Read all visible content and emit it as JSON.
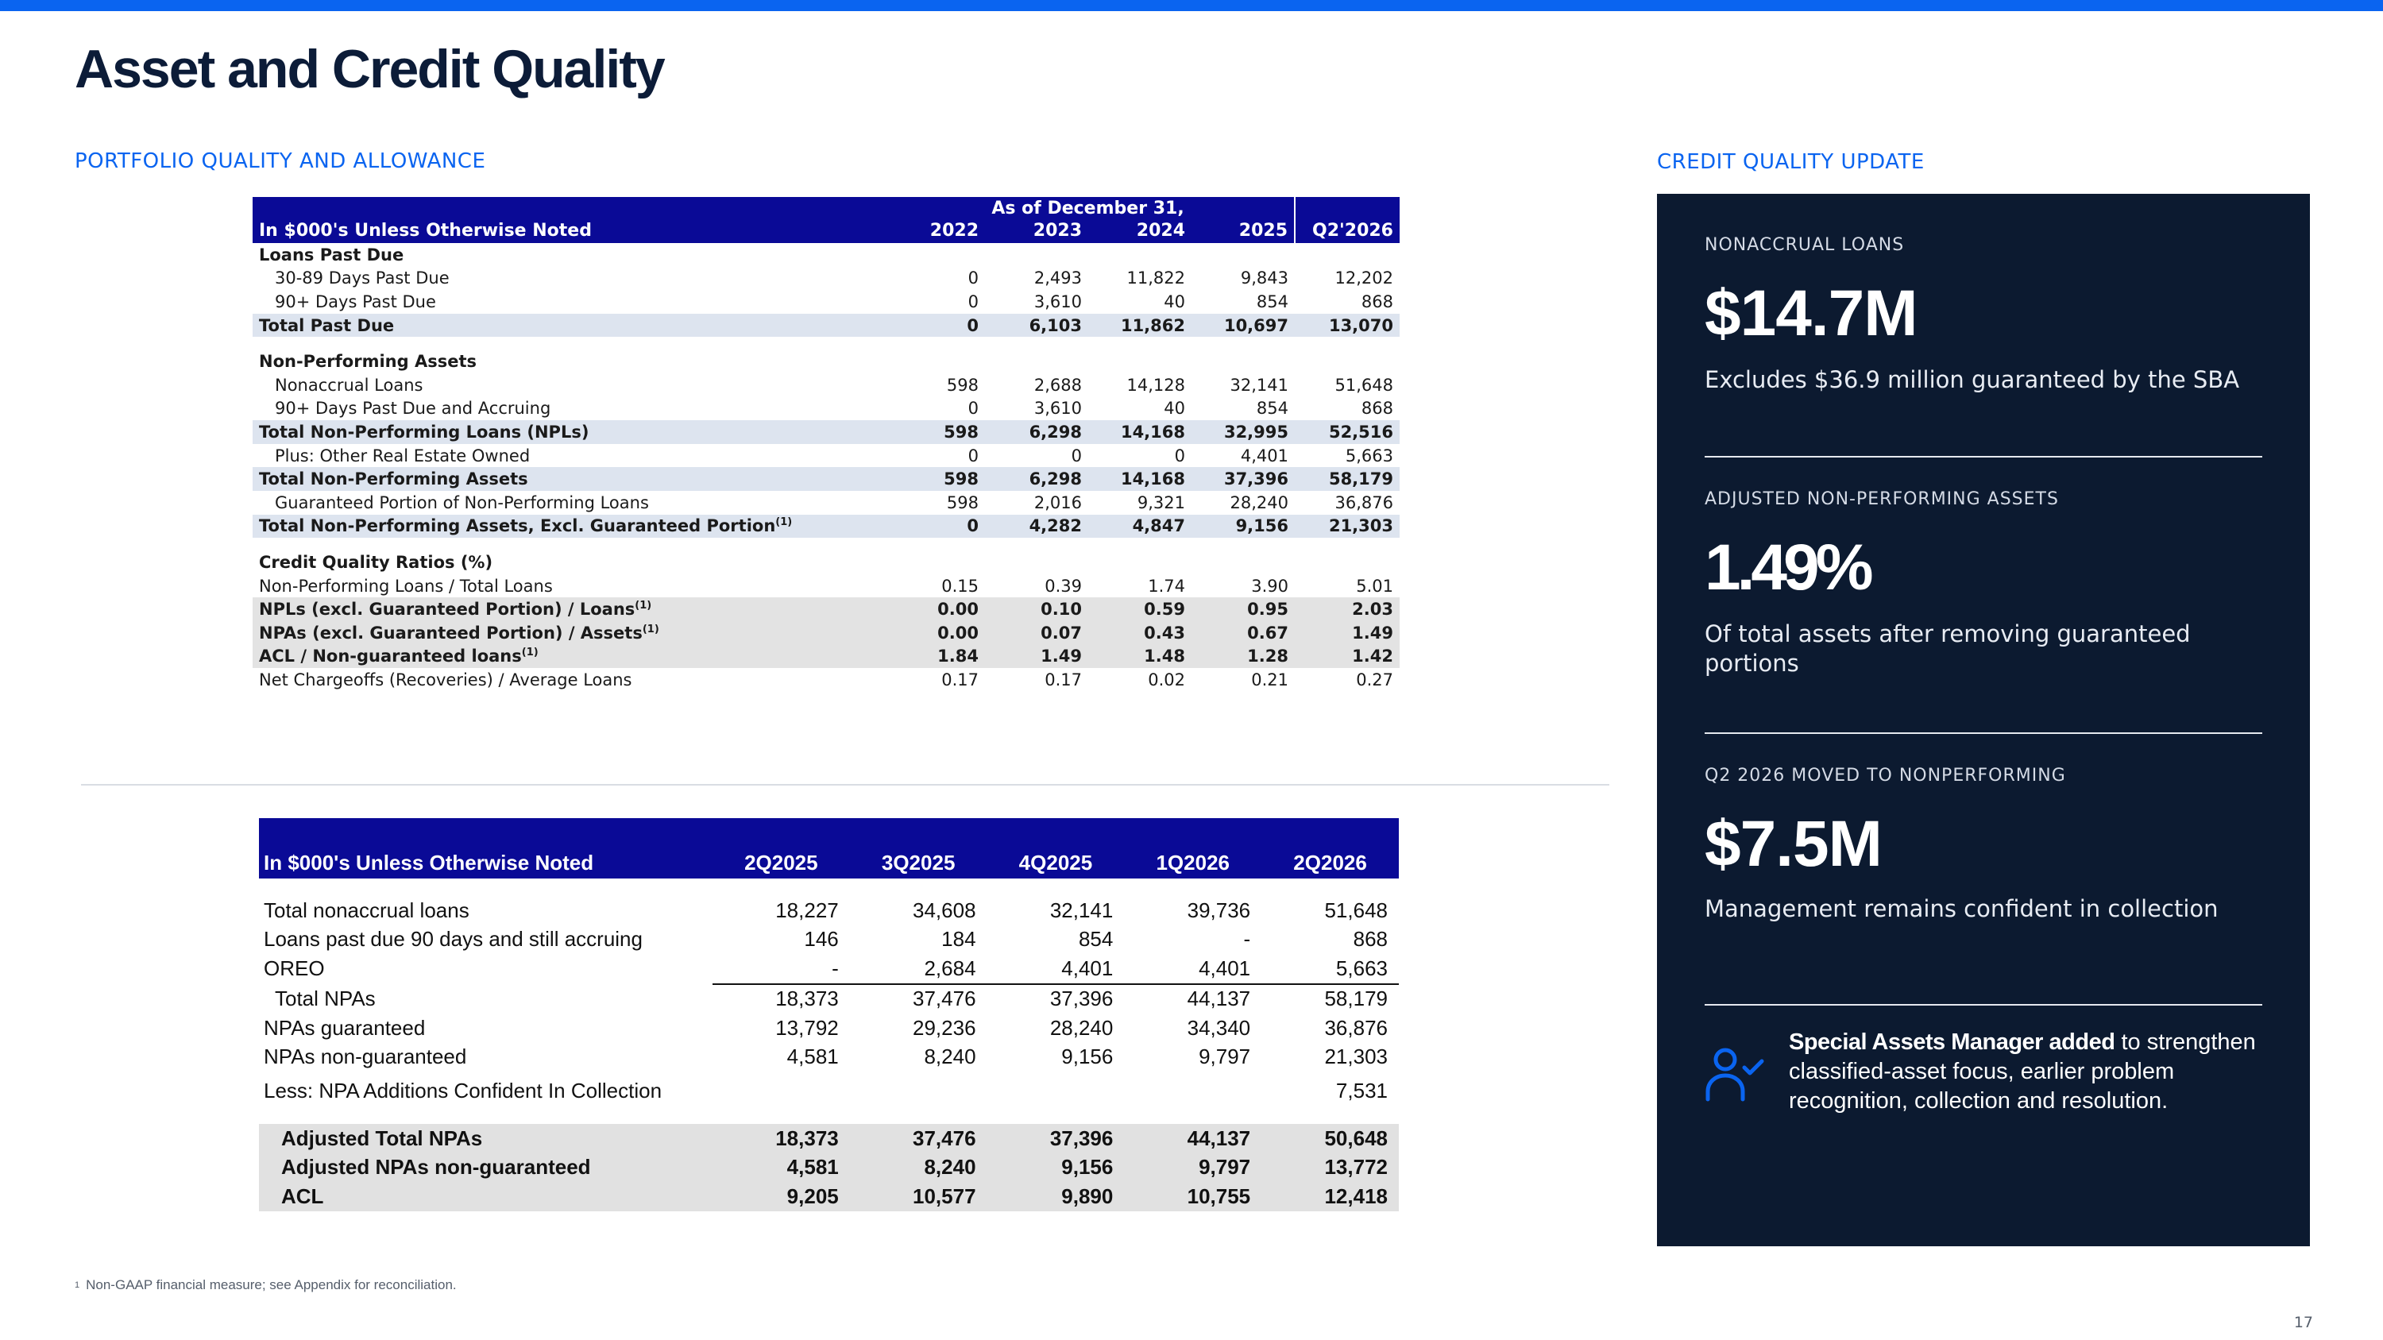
{
  "page": {
    "title": "Asset and Credit Quality",
    "left_section_label": "PORTFOLIO QUALITY AND ALLOWANCE",
    "right_section_label": "CREDIT QUALITY UPDATE",
    "page_number": "17",
    "footnote_mark": "1",
    "footnote": "Non-GAAP financial measure; see Appendix for reconciliation."
  },
  "annual_table": {
    "super_header": "As of December 31,",
    "unit_header": "In $000's Unless Otherwise Noted",
    "columns": [
      "2022",
      "2023",
      "2024",
      "2025",
      "Q2'2026"
    ],
    "sections": {
      "past_due": "Loans Past Due",
      "npa": "Non-Performing Assets",
      "ratios": "Credit Quality Ratios (%)"
    },
    "rows": [
      {
        "label": "30-89 Days Past Due",
        "values": [
          "0",
          "2,493",
          "11,822",
          "9,843",
          "12,202"
        ]
      },
      {
        "label": "90+ Days Past Due",
        "values": [
          "0",
          "3,610",
          "40",
          "854",
          "868"
        ]
      },
      {
        "label": "Total Past Due",
        "values": [
          "0",
          "6,103",
          "11,862",
          "10,697",
          "13,070"
        ]
      },
      {
        "label": "Nonaccrual Loans",
        "values": [
          "598",
          "2,688",
          "14,128",
          "32,141",
          "51,648"
        ]
      },
      {
        "label": "90+ Days Past Due and Accruing",
        "values": [
          "0",
          "3,610",
          "40",
          "854",
          "868"
        ]
      },
      {
        "label": "Total Non-Performing Loans (NPLs)",
        "values": [
          "598",
          "6,298",
          "14,168",
          "32,995",
          "52,516"
        ]
      },
      {
        "label": "Plus: Other Real Estate Owned",
        "values": [
          "0",
          "0",
          "0",
          "4,401",
          "5,663"
        ]
      },
      {
        "label": "Total Non-Performing Assets",
        "values": [
          "598",
          "6,298",
          "14,168",
          "37,396",
          "58,179"
        ]
      },
      {
        "label": "Guaranteed Portion of Non-Performing Loans",
        "values": [
          "598",
          "2,016",
          "9,321",
          "28,240",
          "36,876"
        ]
      },
      {
        "label": "Total Non-Performing Assets, Excl. Guaranteed Portion",
        "mark": "(1)",
        "values": [
          "0",
          "4,282",
          "4,847",
          "9,156",
          "21,303"
        ]
      },
      {
        "label": "Non-Performing Loans / Total Loans",
        "values": [
          "0.15",
          "0.39",
          "1.74",
          "3.90",
          "5.01"
        ]
      },
      {
        "label": "NPLs (excl. Guaranteed Portion) / Loans",
        "mark": "(1)",
        "values": [
          "0.00",
          "0.10",
          "0.59",
          "0.95",
          "2.03"
        ]
      },
      {
        "label": "NPAs (excl. Guaranteed Portion) / Assets",
        "mark": "(1)",
        "values": [
          "0.00",
          "0.07",
          "0.43",
          "0.67",
          "1.49"
        ]
      },
      {
        "label": "ACL / Non-guaranteed loans",
        "mark": "(1)",
        "values": [
          "1.84",
          "1.49",
          "1.48",
          "1.28",
          "1.42"
        ]
      },
      {
        "label": "Net Chargeoffs (Recoveries) / Average Loans",
        "values": [
          "0.17",
          "0.17",
          "0.02",
          "0.21",
          "0.27"
        ]
      }
    ]
  },
  "quarterly_table": {
    "unit_header": "In $000's Unless Otherwise Noted",
    "columns": [
      "2Q2025",
      "3Q2025",
      "4Q2025",
      "1Q2026",
      "2Q2026"
    ],
    "rows": [
      {
        "label": "Total nonaccrual loans",
        "values": [
          "18,227",
          "34,608",
          "32,141",
          "39,736",
          "51,648"
        ]
      },
      {
        "label": "Loans past due 90 days and still accruing",
        "values": [
          "146",
          "184",
          "854",
          "-",
          "868"
        ]
      },
      {
        "label": "OREO",
        "values": [
          "-",
          "2,684",
          "4,401",
          "4,401",
          "5,663"
        ]
      },
      {
        "label": "Total NPAs",
        "values": [
          "18,373",
          "37,476",
          "37,396",
          "44,137",
          "58,179"
        ]
      },
      {
        "label": "NPAs guaranteed",
        "values": [
          "13,792",
          "29,236",
          "28,240",
          "34,340",
          "36,876"
        ]
      },
      {
        "label": "NPAs non-guaranteed",
        "values": [
          "4,581",
          "8,240",
          "9,156",
          "9,797",
          "21,303"
        ]
      },
      {
        "label": "Less: NPA Additions Confident In Collection",
        "values": [
          "",
          "",
          "",
          "",
          "7,531"
        ]
      },
      {
        "label": "Adjusted Total NPAs",
        "values": [
          "18,373",
          "37,476",
          "37,396",
          "44,137",
          "50,648"
        ]
      },
      {
        "label": "Adjusted NPAs non-guaranteed",
        "values": [
          "4,581",
          "8,240",
          "9,156",
          "9,797",
          "13,772"
        ]
      },
      {
        "label": "ACL",
        "values": [
          "9,205",
          "10,577",
          "9,890",
          "10,755",
          "12,418"
        ]
      }
    ]
  },
  "panel": {
    "metrics": [
      {
        "label": "NONACCRUAL LOANS",
        "value": "$14.7M",
        "desc": "Excludes $36.9 million guaranteed by the SBA"
      },
      {
        "label": "ADJUSTED NON-PERFORMING ASSETS",
        "value": "1.49%",
        "desc": "Of total assets after removing guaranteed portions"
      },
      {
        "label": "Q2 2026 MOVED TO NONPERFORMING",
        "value": "$7.5M",
        "desc": "Management remains confident in collection"
      }
    ],
    "note_bold": "Special Assets Manager added",
    "note_rest": " to strengthen classified-asset focus, earlier problem recognition, collection and resolution.",
    "note_icon": "user-check-icon",
    "accent_color": "#0a64f0",
    "background_color": "#0c1a30"
  }
}
